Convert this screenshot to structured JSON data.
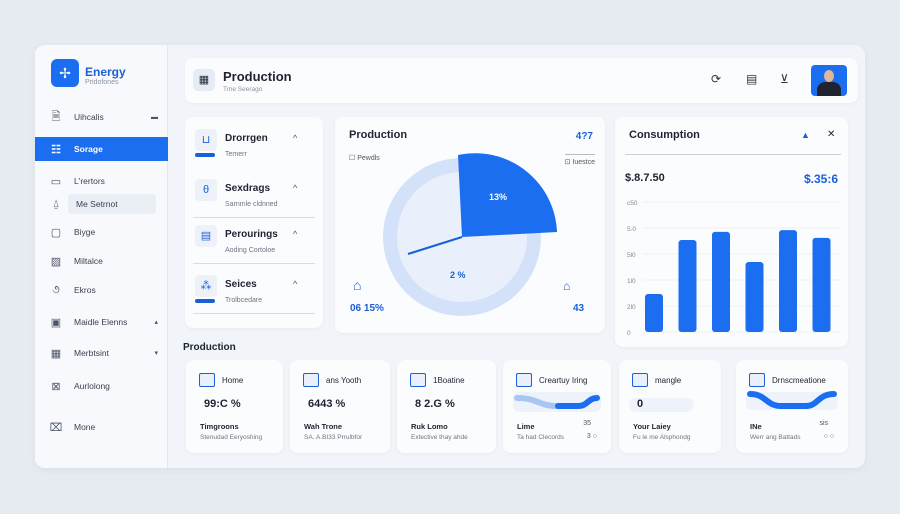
{
  "brand": {
    "name": "Energy",
    "subtitle": "Pridofones",
    "icon": "fan-icon"
  },
  "sidebar": {
    "items": [
      {
        "label": "Uihcalis",
        "icon": "document-icon",
        "caret": "▬"
      },
      {
        "label": "Sorage",
        "icon": "battery-icon",
        "active": true
      },
      {
        "label": "L'rertors",
        "icon": "monitor-icon"
      },
      {
        "label": "Me Setrnot",
        "icon": "bell-icon"
      },
      {
        "label": "Biyge",
        "icon": "folder-icon"
      },
      {
        "label": "Miltalce",
        "icon": "chart-icon"
      },
      {
        "label": "Ekros",
        "icon": "spiral-icon"
      },
      {
        "label": "Maidle Elenns",
        "icon": "panel-icon",
        "caret": "▴"
      },
      {
        "label": "Merbtsint",
        "icon": "calendar-icon",
        "caret": "▾"
      },
      {
        "label": "Aurlolong",
        "icon": "network-icon"
      },
      {
        "label": "Mone",
        "icon": "plug-icon"
      }
    ]
  },
  "header": {
    "title": "Production",
    "subtitle": "Tme Seerago",
    "icons": [
      "refresh-icon",
      "list-icon",
      "inbox-icon"
    ]
  },
  "list": [
    {
      "title": "Drorrgen",
      "sub": "Temerr"
    },
    {
      "title": "Sexdrags",
      "sub": "Sarnmle cldnned"
    },
    {
      "title": "Perourings",
      "sub": "Aoding Cortoloe"
    },
    {
      "title": "Seices",
      "sub": "Trolbcedare"
    }
  ],
  "production": {
    "title": "Production",
    "value": "4?7",
    "legend_left": "Pewdls",
    "legend_right": "Iuestce",
    "slice_label": "13%",
    "center_label": "2 %",
    "left_value": "06 15%",
    "right_value": "43"
  },
  "consumption": {
    "title": "Consumption",
    "value_left": "$.8.7.50",
    "value_right": "$.35:6"
  },
  "chart_data": {
    "type": "bar",
    "title": "Consumption",
    "ytick_labels": [
      "0",
      "2l0",
      "1l0",
      "5l0",
      "5.0",
      "c50"
    ],
    "ylim": [
      0,
      5
    ],
    "values": [
      1.46,
      3.54,
      3.85,
      2.69,
      3.92,
      3.62
    ],
    "color": "#1b6ef0"
  },
  "section_label": "Production",
  "cards": [
    {
      "title": "Home",
      "value": "99:C %",
      "name": "Timgroons",
      "desc": "Stenudad Eeryoshing",
      "icon": "home-icon"
    },
    {
      "title": "ans Yooth",
      "value": "6443 %",
      "name": "Wah Trone",
      "desc": "SA. A.BI33 Prrulbfor",
      "icon": "tools-icon"
    },
    {
      "title": "1Boatine",
      "value": "8 2.G %",
      "name": "Ruk Lomo",
      "desc": "Extective thay ahde",
      "icon": "eye-icon"
    },
    {
      "title": "Creartuy Iring",
      "value": "",
      "name": "Lime",
      "desc": "Ta had Clecords",
      "r1": "35",
      "r2": "3 ○",
      "icon": "grid-icon"
    },
    {
      "title": "mangle",
      "value": "0",
      "name": "Your Laiey",
      "desc": "Fu le me Alsphondg",
      "icon": "image-icon"
    },
    {
      "title": "Drnscmeatione",
      "value": "",
      "name": "INe",
      "desc": "Werr ang Battads",
      "r1": "sis",
      "r2": "○ ○",
      "icon": "clock-icon"
    }
  ]
}
